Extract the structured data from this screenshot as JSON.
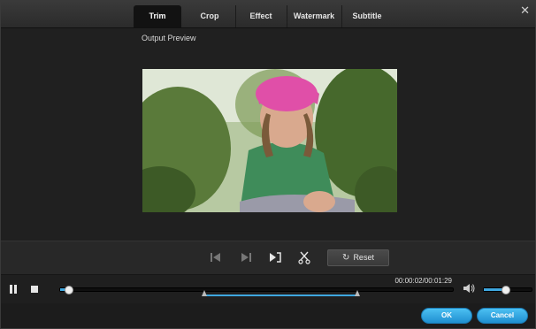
{
  "tabs": [
    {
      "label": "Trim",
      "active": true
    },
    {
      "label": "Crop",
      "active": false
    },
    {
      "label": "Effect",
      "active": false
    },
    {
      "label": "Watermark",
      "active": false
    },
    {
      "label": "Subtitle",
      "active": false
    }
  ],
  "close_icon": "close-icon",
  "preview": {
    "label": "Output Preview"
  },
  "controls": {
    "icons": [
      "previous-marker-icon",
      "next-marker-icon",
      "set-trim-point-icon",
      "split-scissors-icon"
    ],
    "reset_label": "Reset",
    "reset_icon": "undo-arrow-icon"
  },
  "timeline": {
    "timecode": "00:00:02/00:01:29",
    "play_icon": "pause-icon",
    "stop_icon": "stop-icon",
    "volume_icon": "speaker-icon",
    "progress_fraction": 0.02,
    "trim_start_fraction": 0.37,
    "trim_end_fraction": 0.76,
    "volume_fraction": 0.45
  },
  "buttons": {
    "ok": "OK",
    "cancel": "Cancel"
  },
  "colors": {
    "accent": "#3ea7df",
    "button": "#2aa6e6"
  }
}
